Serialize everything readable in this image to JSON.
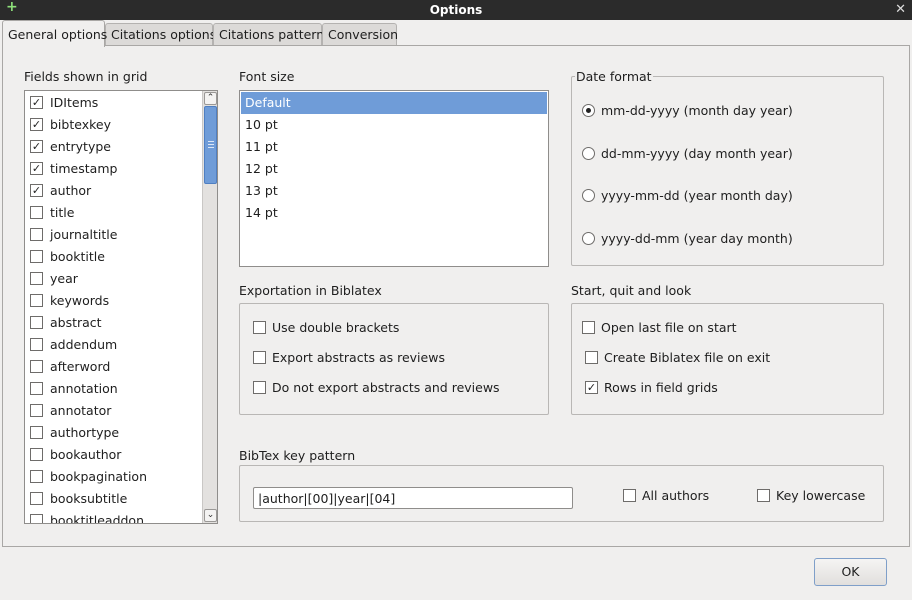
{
  "window": {
    "title": "Options"
  },
  "tabs": [
    "General options",
    "Citations options",
    "Citations pattern",
    "Conversion"
  ],
  "fields": {
    "label": "Fields shown in grid",
    "items": [
      {
        "name": "IDItems",
        "checked": true
      },
      {
        "name": "bibtexkey",
        "checked": true
      },
      {
        "name": "entrytype",
        "checked": true
      },
      {
        "name": "timestamp",
        "checked": true
      },
      {
        "name": "author",
        "checked": true
      },
      {
        "name": "title",
        "checked": false
      },
      {
        "name": "journaltitle",
        "checked": false
      },
      {
        "name": "booktitle",
        "checked": false
      },
      {
        "name": "year",
        "checked": false
      },
      {
        "name": "keywords",
        "checked": false
      },
      {
        "name": "abstract",
        "checked": false
      },
      {
        "name": "addendum",
        "checked": false
      },
      {
        "name": "afterword",
        "checked": false
      },
      {
        "name": "annotation",
        "checked": false
      },
      {
        "name": "annotator",
        "checked": false
      },
      {
        "name": "authortype",
        "checked": false
      },
      {
        "name": "bookauthor",
        "checked": false
      },
      {
        "name": "bookpagination",
        "checked": false
      },
      {
        "name": "booksubtitle",
        "checked": false
      },
      {
        "name": "booktitleaddon",
        "checked": false
      }
    ]
  },
  "font_size": {
    "label": "Font size",
    "options": [
      "Default",
      "10 pt",
      "11 pt",
      "12 pt",
      "13 pt",
      "14 pt"
    ],
    "selected": "Default"
  },
  "date_format": {
    "label": "Date format",
    "options": [
      {
        "label": "mm-dd-yyyy (month day year)",
        "selected": true
      },
      {
        "label": "dd-mm-yyyy (day month year)",
        "selected": false
      },
      {
        "label": "yyyy-mm-dd (year month day)",
        "selected": false
      },
      {
        "label": "yyyy-dd-mm (year day month)",
        "selected": false
      }
    ]
  },
  "exportation": {
    "label": "Exportation in Biblatex",
    "options": [
      {
        "label": "Use double brackets",
        "checked": false
      },
      {
        "label": "Export abstracts as reviews",
        "checked": false
      },
      {
        "label": "Do not export abstracts and reviews",
        "checked": false
      }
    ]
  },
  "start_quit": {
    "label": "Start, quit and look",
    "options": [
      {
        "label": "Open last file on start",
        "checked": false
      },
      {
        "label": "Create Biblatex file on exit",
        "checked": false
      },
      {
        "label": "Rows in field grids",
        "checked": true
      }
    ]
  },
  "bibtex_key": {
    "label": "BibTex key pattern",
    "value": "|author|[00]|year|[04]",
    "all_authors": {
      "label": "All authors",
      "checked": false
    },
    "key_lowercase": {
      "label": "Key lowercase",
      "checked": false
    }
  },
  "buttons": {
    "ok": "OK"
  },
  "icons": {
    "check": "✓",
    "close": "✕",
    "plus": "+",
    "scroll_up": "⌃",
    "scroll_down": "⌄"
  },
  "colors": {
    "selection": "#6f9cd8",
    "titlebar": "#2b2b2b"
  }
}
